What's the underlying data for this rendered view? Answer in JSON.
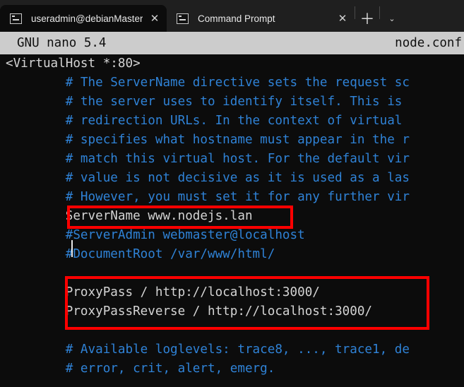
{
  "window": {
    "tabs": [
      {
        "title": "useradmin@debianMaster: ~",
        "icon": "terminal-icon",
        "active": true,
        "close_label": "✕"
      },
      {
        "title": "Command Prompt",
        "icon": "terminal-icon",
        "active": false,
        "close_label": "✕"
      }
    ],
    "new_tab_label": "＋",
    "dropdown_label": "⌄"
  },
  "nano": {
    "version_label": "GNU nano 5.4",
    "filename": "node.conf"
  },
  "editor": {
    "lines": [
      {
        "text": "<VirtualHost *:80>",
        "style": "plain"
      },
      {
        "text": "        # The ServerName directive sets the request sc",
        "style": "comment"
      },
      {
        "text": "        # the server uses to identify itself. This is ",
        "style": "comment"
      },
      {
        "text": "        # redirection URLs. In the context of virtual ",
        "style": "comment"
      },
      {
        "text": "        # specifies what hostname must appear in the r",
        "style": "comment"
      },
      {
        "text": "        # match this virtual host. For the default vir",
        "style": "comment"
      },
      {
        "text": "        # value is not decisive as it is used as a las",
        "style": "comment"
      },
      {
        "text": "        # However, you must set it for any further vir",
        "style": "comment"
      },
      {
        "text": "        ServerName www.nodejs.lan",
        "style": "plain"
      },
      {
        "text": "        #ServerAdmin webmaster@localhost",
        "style": "comment"
      },
      {
        "text": "        #DocumentRoot /var/www/html/",
        "style": "comment"
      },
      {
        "text": "",
        "style": "plain"
      },
      {
        "text": "        ProxyPass / http://localhost:3000/",
        "style": "plain"
      },
      {
        "text": "        ProxyPassReverse / http://localhost:3000/",
        "style": "plain"
      },
      {
        "text": "",
        "style": "plain"
      },
      {
        "text": "        # Available loglevels: trace8, ..., trace1, de",
        "style": "comment"
      },
      {
        "text": "        # error, crit, alert, emerg.",
        "style": "comment"
      }
    ]
  },
  "annotations": {
    "color": "#ff0000",
    "boxes": [
      {
        "name": "servername-highlight",
        "target": "ServerName www.nodejs.lan"
      },
      {
        "name": "proxypass-highlight",
        "target": "ProxyPass / http://localhost:3000/ , ProxyPassReverse / http://localhost:3000/"
      }
    ]
  },
  "colors": {
    "terminal_background": "#0c0c0c",
    "tabstrip_background": "#1f1f1f",
    "nano_bar_background": "#cccccc",
    "comment_text": "#2f82d6",
    "plain_text": "#d4d4d4",
    "annotation_red": "#ff0000"
  }
}
